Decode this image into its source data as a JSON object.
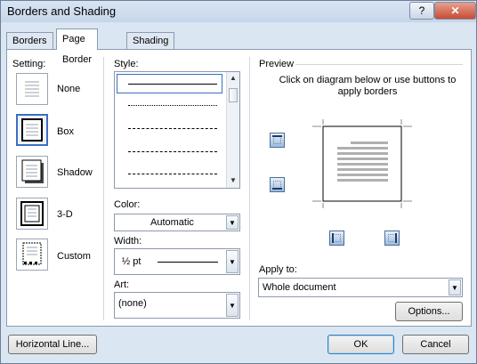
{
  "window": {
    "title": "Borders and Shading",
    "help_label": "?",
    "close_label": "✕"
  },
  "tabs": [
    {
      "label": "Borders",
      "active": false
    },
    {
      "label": "Page Border",
      "active": true
    },
    {
      "label": "Shading",
      "active": false
    }
  ],
  "setting": {
    "label": "Setting:",
    "items": [
      {
        "label": "None",
        "selected": false
      },
      {
        "label": "Box",
        "selected": true
      },
      {
        "label": "Shadow",
        "selected": false
      },
      {
        "label": "3-D",
        "selected": false
      },
      {
        "label": "Custom",
        "selected": false
      }
    ]
  },
  "style": {
    "label": "Style:",
    "selected_index": 0
  },
  "color": {
    "label": "Color:",
    "value": "Automatic"
  },
  "width": {
    "label": "Width:",
    "value": "½ pt"
  },
  "art": {
    "label": "Art:",
    "value": "(none)"
  },
  "preview": {
    "label": "Preview",
    "instructions": "Click on diagram below or use buttons to apply borders"
  },
  "apply_to": {
    "label": "Apply to:",
    "value": "Whole document"
  },
  "buttons": {
    "options": "Options...",
    "horizontal_line": "Horizontal Line...",
    "ok": "OK",
    "cancel": "Cancel"
  },
  "colors": {
    "accent": "#3c6fc3",
    "title_bar": "#c6d6ea",
    "close": "#c84b35"
  }
}
